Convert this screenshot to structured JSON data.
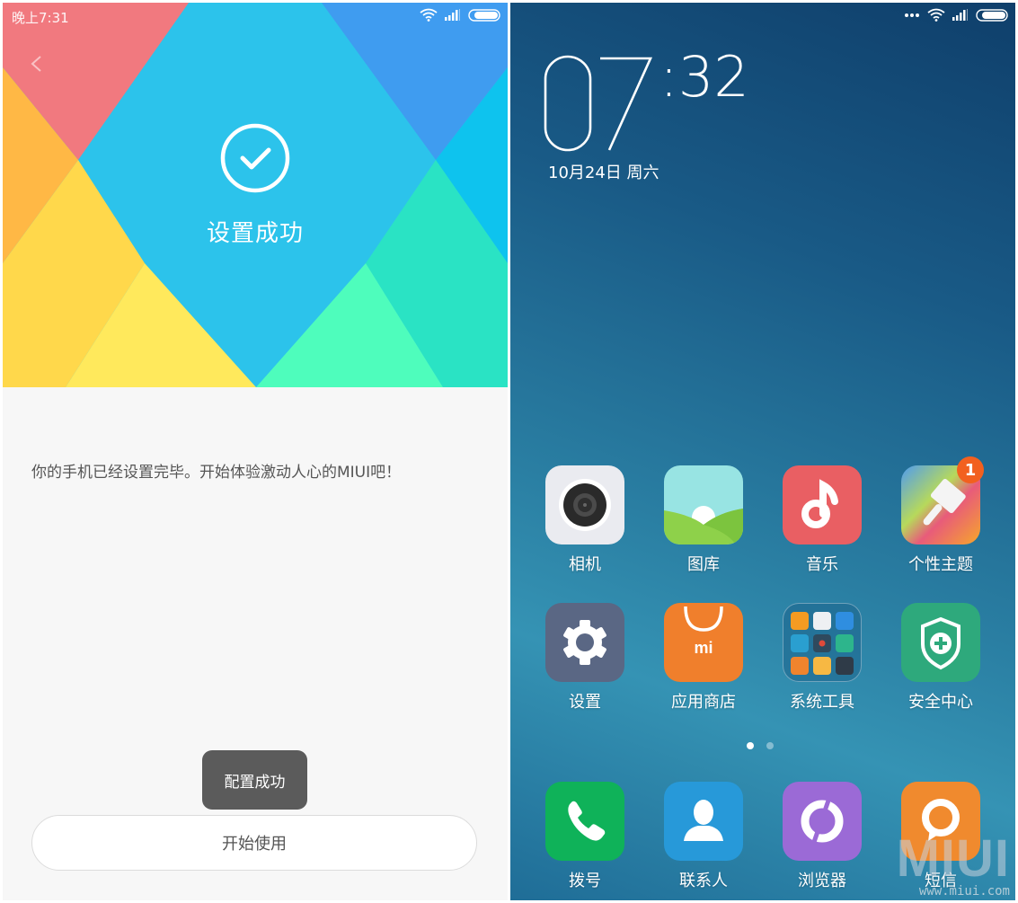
{
  "left_screen": {
    "statusbar": {
      "time": "晚上7:31",
      "icons": [
        "wifi-icon",
        "signal-icon",
        "battery-icon"
      ]
    },
    "back_icon": "chevron-left-icon",
    "hero": {
      "icon": "check-circle-icon",
      "title": "设置成功"
    },
    "colors": {
      "pink": "#f1797f",
      "blue_center": "#2cc3eb",
      "blue_top_right": "#3f9cf0",
      "cyan_right": "#0ec3ee",
      "orange": "#ffb845",
      "yellow": "#ffd84b",
      "yellow_light": "#ffe95c",
      "green_light": "#4efdbc",
      "teal": "#2ae3c4",
      "page_bg": "#f7f7f7"
    },
    "message": "你的手机已经设置完毕。开始体验激动人心的MIUI吧！",
    "toast": "配置成功",
    "start_button": "开始使用"
  },
  "right_screen": {
    "statusbar": {
      "icons": [
        "more-dots-icon",
        "wifi-icon",
        "signal-icon",
        "battery-icon"
      ]
    },
    "clock": {
      "hour": "07",
      "minute": ":32"
    },
    "date": "10月24日 周六",
    "apps_row1": [
      {
        "label": "相机",
        "icon": "camera-icon",
        "color": "#eaebf0"
      },
      {
        "label": "图库",
        "icon": "gallery-icon",
        "color": "#98e4e3"
      },
      {
        "label": "音乐",
        "icon": "music-note-icon",
        "color": "#e95f63"
      },
      {
        "label": "个性主题",
        "icon": "paintbrush-icon",
        "color": "#e96a6a",
        "badge": "1"
      }
    ],
    "apps_row2": [
      {
        "label": "设置",
        "icon": "gear-icon",
        "color": "#5a6784"
      },
      {
        "label": "应用商店",
        "icon": "shopping-bag-icon",
        "color": "#f07f2c",
        "glyph": "mi"
      },
      {
        "label": "系统工具",
        "icon": "folder-icon",
        "color": "#2a7da4"
      },
      {
        "label": "安全中心",
        "icon": "shield-plus-icon",
        "color": "#2ea97c"
      }
    ],
    "page_indicator": {
      "pages": 2,
      "current": 1
    },
    "dock": [
      {
        "label": "拨号",
        "icon": "phone-icon",
        "color": "#0fb259"
      },
      {
        "label": "联系人",
        "icon": "contact-icon",
        "color": "#2799d9"
      },
      {
        "label": "浏览器",
        "icon": "browser-icon",
        "color": "#9b6ad6"
      },
      {
        "label": "短信",
        "icon": "message-bubble-icon",
        "color": "#f08a2e"
      }
    ],
    "watermark": {
      "logo": "MIUI",
      "url": "www.miui.com"
    }
  }
}
